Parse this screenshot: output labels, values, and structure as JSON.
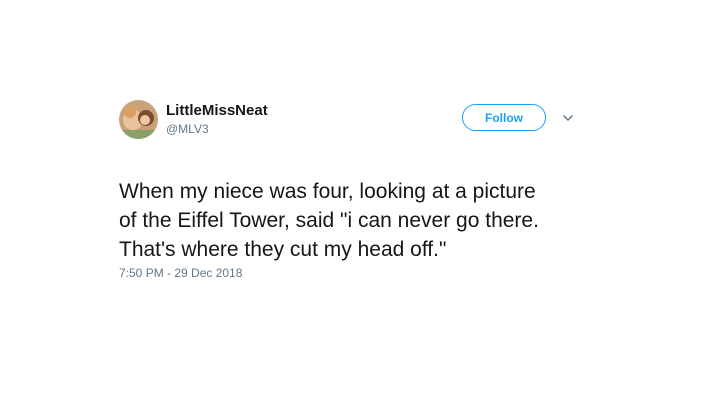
{
  "user": {
    "display_name": "LittleMissNeat",
    "handle": "@MLV3",
    "avatar_icon": "profile-photo"
  },
  "actions": {
    "follow_label": "Follow",
    "menu_icon": "chevron-down-icon"
  },
  "tweet": {
    "lines": [
      "When my niece was four, looking at a picture",
      "of the Eiffel Tower, said \"i can never go there.",
      "That's where they cut my head off.\""
    ],
    "timestamp": "7:50 PM - 29 Dec 2018"
  },
  "colors": {
    "accent": "#1da1f2",
    "text": "#14171a",
    "secondary": "#657786"
  }
}
